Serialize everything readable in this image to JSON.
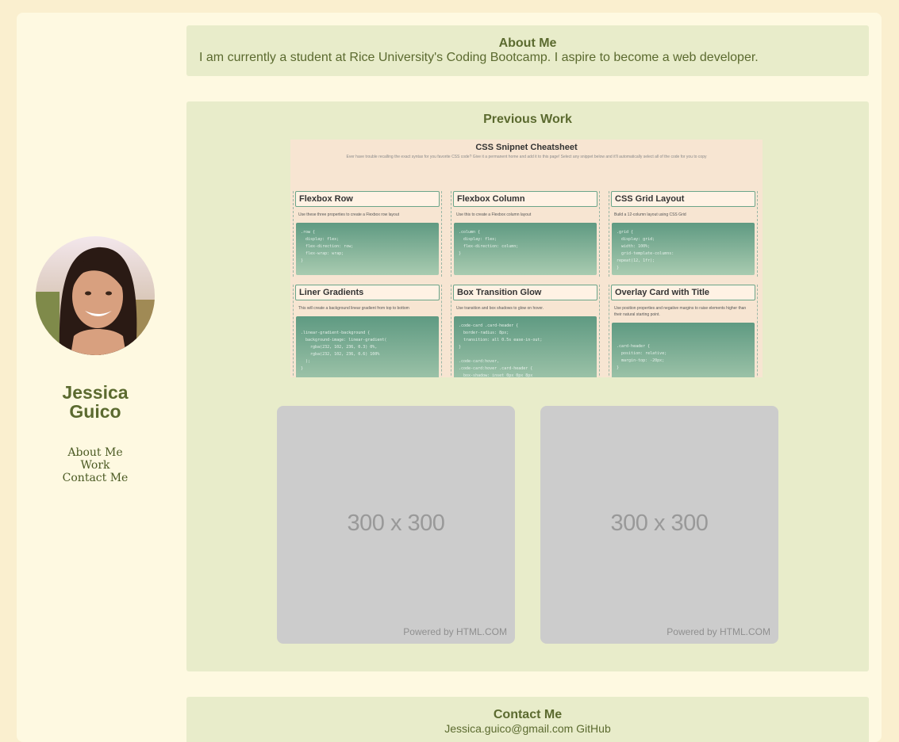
{
  "profile": {
    "name_line1": "Jessica",
    "name_line2": "Guico",
    "photo_alt": "Jessica Guico"
  },
  "nav": {
    "items": [
      "About Me",
      "Work",
      "Contact Me"
    ]
  },
  "about": {
    "title": "About Me",
    "text": "I am currently a student at Rice University's Coding Bootcamp. I aspire to become a web developer."
  },
  "work": {
    "title": "Previous Work",
    "cheatsheet": {
      "title": "CSS Snipnet Cheatsheet",
      "subtitle": "Ever have trouble recalling the exact syntax for you favorite CSS code? Give it a permanent home and add it to this page! Select any snippet below and it'll automatically select all of the code for you to copy",
      "cards": [
        {
          "title": "Flexbox Row",
          "desc": "Use these three properties to create a Flexbox row layout",
          "code": ".row {\n  display: flex;\n  flex-direction: row;\n  flex-wrap: wrap;\n}"
        },
        {
          "title": "Flexbox Column",
          "desc": "Use this to create a Flexbox column layout",
          "code": ".column {\n  display: flex;\n  flex-direction: column;\n}"
        },
        {
          "title": "CSS Grid Layout",
          "desc": "Build a 12-column layout using CSS Grid",
          "code": ".grid {\n  display: grid;\n  width: 100%;\n  grid-template-columns:\nrepeat(12, 1fr);\n}"
        },
        {
          "title": "Liner Gradients",
          "desc": "This will create a background linear gradient from top to bottom",
          "code": "\n.linear-gradient-background {\n  background-image: linear-gradient(\n    rgba(232, 102, 236, 0.3) 0%,\n    rgba(232, 102, 236, 0.6) 100%\n  );\n}"
        },
        {
          "title": "Box Transition Glow",
          "desc": "Use transition and box shadows to glow on hover.",
          "code": ".code-card .card-header {\n  border-radius: 8px;\n  transition: all 0.5s ease-in-out;\n}\n\n.code-card:hover,\n.code-card:hover .card-header {\n  box-shadow: inset 0px 0px 8px"
        },
        {
          "title": "Overlay Card with Title",
          "desc": "Use position properties and negative margins to raise elements higher than their natural starting point.",
          "code": "\n\n.card-header {\n  position: relative;\n  margin-top: -20px;\n}"
        }
      ]
    },
    "placeholders": [
      {
        "label": "300 x 300",
        "footer": "Powered by HTML.COM"
      },
      {
        "label": "300 x 300",
        "footer": "Powered by HTML.COM"
      }
    ]
  },
  "contact": {
    "title": "Contact Me",
    "text": "Jessica.guico@gmail.com   GitHub"
  }
}
